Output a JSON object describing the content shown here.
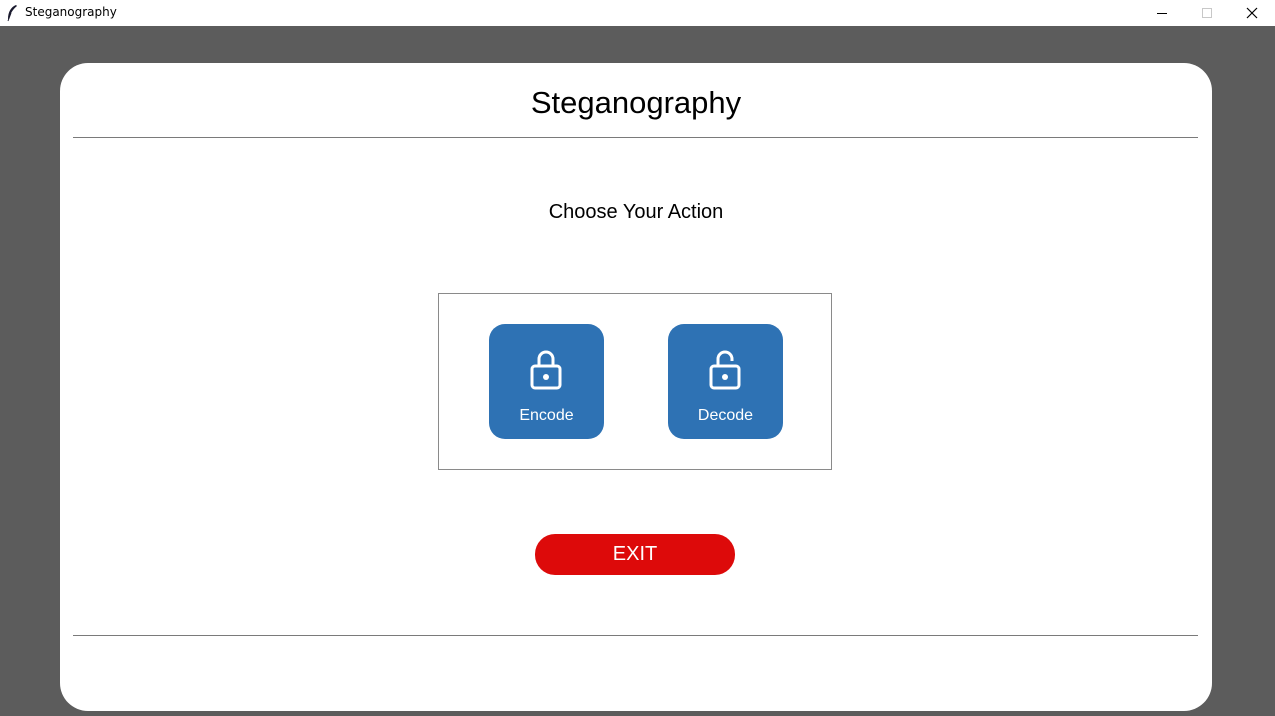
{
  "window": {
    "title": "Steganography",
    "icon": "feather-icon",
    "controls": [
      "minimize-icon",
      "maximize-icon",
      "close-icon"
    ]
  },
  "page": {
    "title": "Steganography",
    "subtitle": "Choose Your Action"
  },
  "actions": [
    {
      "label": "Encode",
      "icon": "lock-icon",
      "color": "#2e72b4"
    },
    {
      "label": "Decode",
      "icon": "unlock-icon",
      "color": "#2e72b4"
    }
  ],
  "exit": {
    "label": "EXIT",
    "color": "#dd0a0a"
  },
  "colors": {
    "backdrop": "#5c5c5c",
    "card": "#ffffff",
    "divider": "#7a7a7a"
  }
}
